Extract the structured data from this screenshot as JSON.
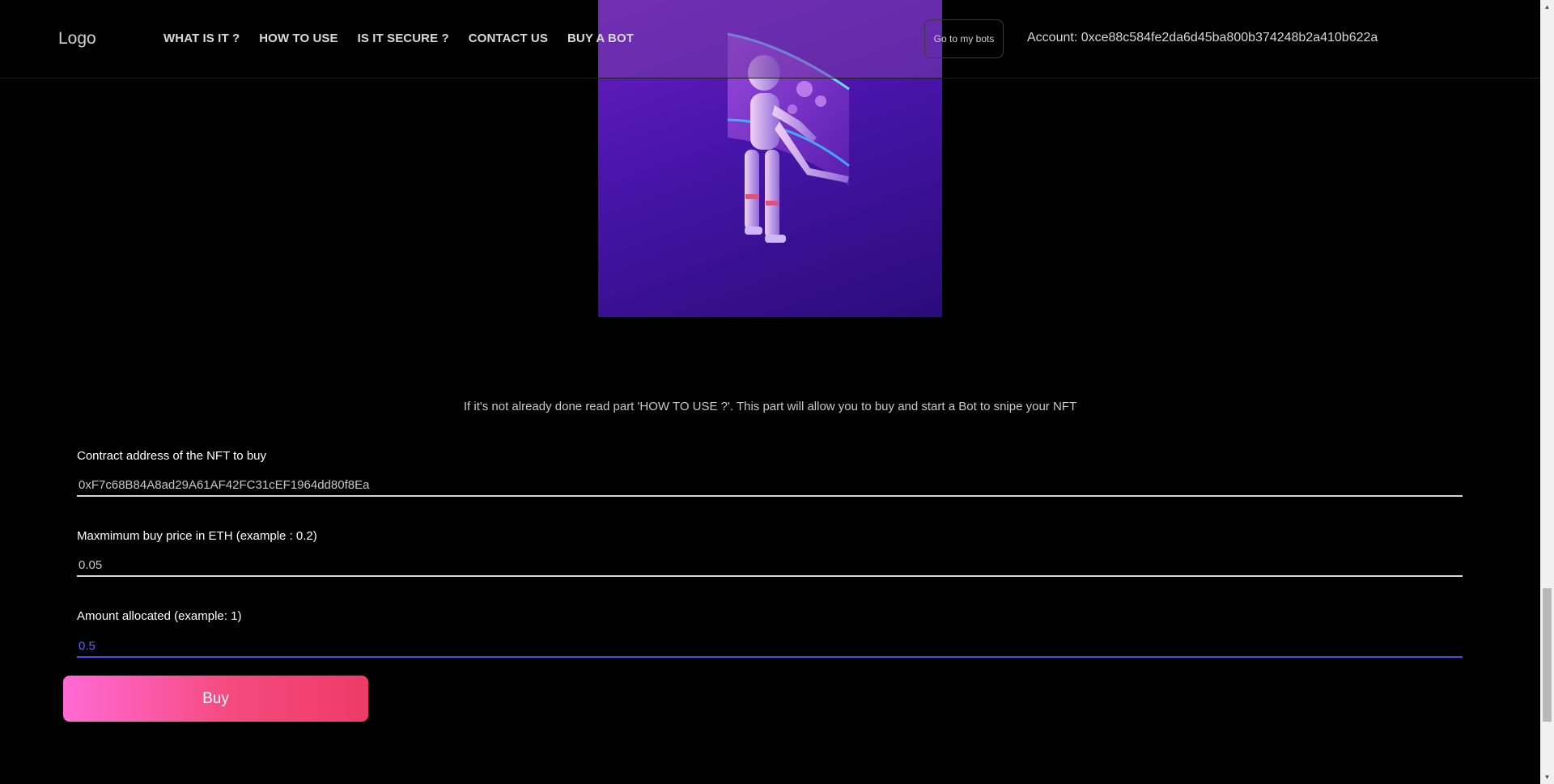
{
  "header": {
    "logo": "Logo",
    "nav": [
      "WHAT IS IT ?",
      "HOW TO USE",
      "IS IT SECURE ?",
      "CONTACT US",
      "BUY A BOT"
    ],
    "my_bots_button": "Go to my bots",
    "account": "Account: 0xce88c584fe2da6d45ba800b374248b2a410b622a"
  },
  "hero": {
    "image": "robot-touching-screen-illustration"
  },
  "intro_text": "If it's not already done read part 'HOW TO USE ?'. This part will allow you to buy and start a Bot to snipe your NFT",
  "form": {
    "contract": {
      "label": "Contract address of the NFT to buy",
      "value": "0xF7c68B84A8ad29A61AF42FC31cEF1964dd80f8Ea"
    },
    "max_price": {
      "label": "Maxmimum buy price in ETH (example : 0.2)",
      "value": "0.05"
    },
    "amount": {
      "label": "Amount allocated (example: 1)",
      "value": "0.5"
    },
    "buy_button": "Buy"
  },
  "colors": {
    "background": "#000000",
    "accent_focus": "#5b3df5",
    "button_gradient_start": "#ff6ad5",
    "button_gradient_end": "#ee3b67",
    "hero_purple": "#4714a8"
  }
}
